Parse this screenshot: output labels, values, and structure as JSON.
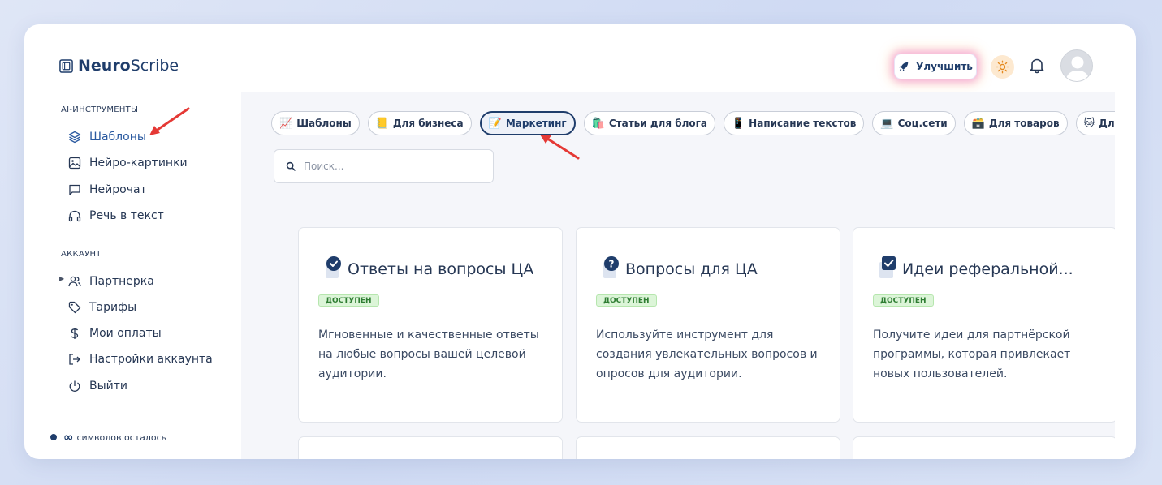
{
  "app": {
    "logo_bold": "Neuro",
    "logo_rest": "Scribe"
  },
  "header": {
    "upgrade_label": "Улучшить",
    "icons": [
      "rocket-icon",
      "sun-icon",
      "bell-icon",
      "avatar"
    ]
  },
  "sidebar": {
    "section_tools": "AI-ИНСТРУМЕНТЫ",
    "tools": [
      {
        "label": "Шаблоны",
        "icon": "layers-icon",
        "active": true
      },
      {
        "label": "Нейро-картинки",
        "icon": "image-icon"
      },
      {
        "label": "Нейрочат",
        "icon": "chat-icon"
      },
      {
        "label": "Речь в текст",
        "icon": "headphones-icon"
      }
    ],
    "section_account": "АККАУНТ",
    "account": [
      {
        "label": "Партнерка",
        "icon": "users-icon"
      },
      {
        "label": "Тарифы",
        "icon": "tag-icon"
      },
      {
        "label": "Мои оплаты",
        "icon": "dollar-icon"
      },
      {
        "label": "Настройки аккаунта",
        "icon": "logout-arrow-icon"
      },
      {
        "label": "Выйти",
        "icon": "power-icon"
      }
    ],
    "credits_symbol": "∞",
    "credits_text": "символов осталось"
  },
  "main": {
    "chips": [
      {
        "emoji": "📈",
        "label": "Шаблоны"
      },
      {
        "emoji": "📒",
        "label": "Для бизнеса"
      },
      {
        "emoji": "📝",
        "label": "Маркетинг",
        "active": true
      },
      {
        "emoji": "🛍️",
        "label": "Статьи для блога"
      },
      {
        "emoji": "📱",
        "label": "Написание текстов"
      },
      {
        "emoji": "💻",
        "label": "Соц.сети"
      },
      {
        "emoji": "🗃️",
        "label": "Для товаров"
      },
      {
        "emoji": "🐱",
        "label": "Для сайта"
      }
    ],
    "search_placeholder": "Поиск...",
    "cards": [
      {
        "title": "Ответы на вопросы ЦА",
        "badge": "ДОСТУПЕН",
        "description": "Мгновенные и качественные ответы на любые вопросы вашей целевой аудитории.",
        "icon": "check-circle-doc-icon"
      },
      {
        "title": "Вопросы для ЦА",
        "badge": "ДОСТУПЕН",
        "description": "Используйте инструмент для создания увлекательных вопросов и опросов для аудитории.",
        "icon": "question-doc-icon"
      },
      {
        "title": "Идеи реферальной...",
        "badge": "ДОСТУПЕН",
        "description": "Получите идеи для партнёрской программы, которая привлекает новых пользователей.",
        "icon": "checkbox-doc-icon"
      }
    ]
  },
  "colors": {
    "brand": "#1f3d6b",
    "accent": "#2b5aa0",
    "badge_bg": "#dcf5d8",
    "badge_text": "#2e7d32",
    "annotation_arrow": "#e53935"
  }
}
